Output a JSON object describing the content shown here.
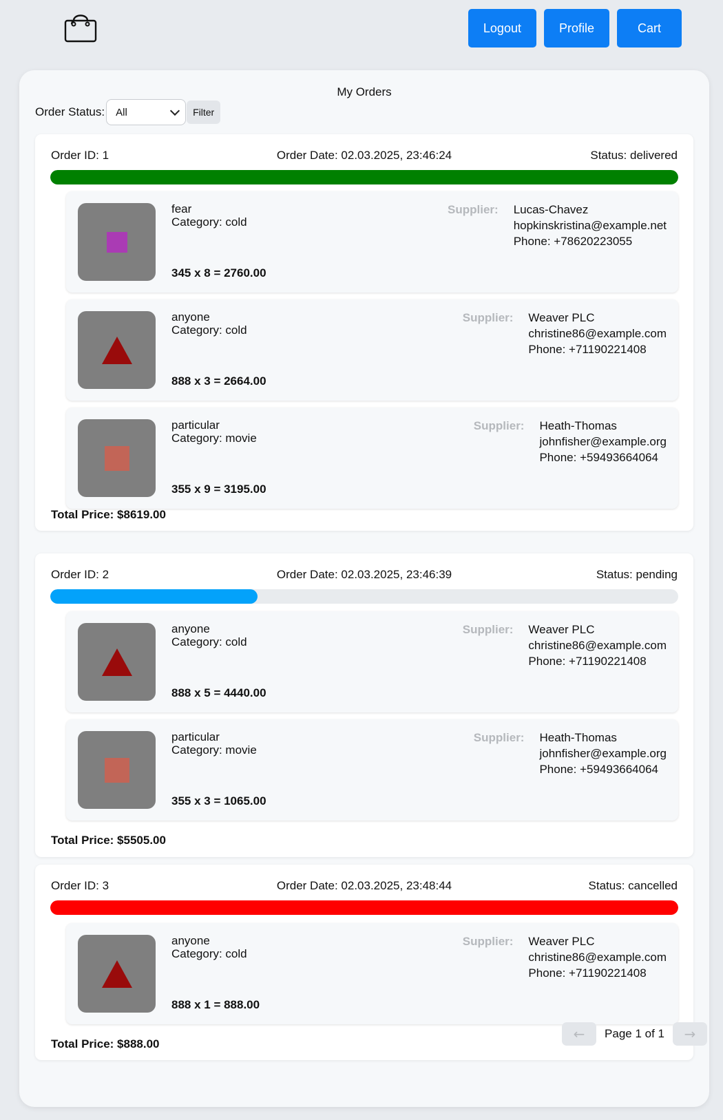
{
  "header": {
    "logo_icon": "shopping-bag-icon",
    "nav": {
      "logout": "Logout",
      "profile": "Profile",
      "cart": "Cart"
    }
  },
  "page": {
    "title": "My Orders",
    "filter": {
      "label": "Order Status:",
      "selected": "All",
      "button": "Filter"
    }
  },
  "orders": [
    {
      "id": "Order ID: 1",
      "date": "Order Date: 02.03.2025, 23:46:24",
      "status": "Status: delivered",
      "progress": 1.0,
      "progress_color": "#008000",
      "items": [
        {
          "name": "fear",
          "category": "Category: cold",
          "price": "345 x 8 = 2760.00",
          "supplier_label": "Supplier:",
          "supplier": "Lucas-Chavez",
          "email": "hopkinskristina@example.net",
          "phone": "Phone: +78620223055",
          "shape": "square",
          "shape_color": "#aa3bb4"
        },
        {
          "name": "anyone",
          "category": "Category: cold",
          "price": "888 x 3 = 2664.00",
          "supplier_label": "Supplier:",
          "supplier": "Weaver PLC",
          "email": "christine86@example.com",
          "phone": "Phone: +71190221408",
          "shape": "triangle",
          "shape_color": "#990b0b"
        },
        {
          "name": "particular",
          "category": "Category: movie",
          "price": "355 x 9 = 3195.00",
          "supplier_label": "Supplier:",
          "supplier": "Heath-Thomas",
          "email": "johnfisher@example.org",
          "phone": "Phone: +59493664064",
          "shape": "square",
          "shape_color": "#c26557"
        }
      ],
      "total": "Total Price: $8619.00"
    },
    {
      "id": "Order ID: 2",
      "date": "Order Date: 02.03.2025, 23:46:39",
      "status": "Status: pending",
      "progress": 0.33,
      "progress_color": "#03a2fa",
      "items": [
        {
          "name": "anyone",
          "category": "Category: cold",
          "price": "888 x 5 = 4440.00",
          "supplier_label": "Supplier:",
          "supplier": "Weaver PLC",
          "email": "christine86@example.com",
          "phone": "Phone: +71190221408",
          "shape": "triangle",
          "shape_color": "#990b0b"
        },
        {
          "name": "particular",
          "category": "Category: movie",
          "price": "355 x 3 = 1065.00",
          "supplier_label": "Supplier:",
          "supplier": "Heath-Thomas",
          "email": "johnfisher@example.org",
          "phone": "Phone: +59493664064",
          "shape": "square",
          "shape_color": "#c26557"
        }
      ],
      "total": "Total Price: $5505.00"
    },
    {
      "id": "Order ID: 3",
      "date": "Order Date: 02.03.2025, 23:48:44",
      "status": "Status: cancelled",
      "progress": 1.0,
      "progress_color": "#ff0000",
      "items": [
        {
          "name": "anyone",
          "category": "Category: cold",
          "price": "888 x 1 = 888.00",
          "supplier_label": "Supplier:",
          "supplier": "Weaver PLC",
          "email": "christine86@example.com",
          "phone": "Phone: +71190221408",
          "shape": "triangle",
          "shape_color": "#990b0b"
        }
      ],
      "total": "Total Price: $888.00"
    }
  ],
  "pagination": {
    "prev": "←",
    "text": "Page 1 of 1",
    "next": "→"
  }
}
